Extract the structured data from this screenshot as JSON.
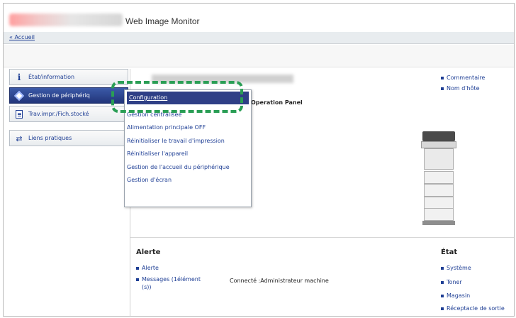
{
  "header": {
    "title": "Web Image Monitor"
  },
  "breadcrumb": {
    "home_link": "« Accueil"
  },
  "sidebar": {
    "items": [
      {
        "label": "État/information",
        "icon": "info-icon"
      },
      {
        "label": "Gestion de périphériq",
        "icon": "device-management-icon"
      },
      {
        "label": "Trav.impr./Fich.stocké",
        "icon": "document-icon"
      },
      {
        "label": "Liens pratiques",
        "icon": "share-link-icon"
      }
    ]
  },
  "main": {
    "operation_panel": "Operation Panel",
    "right_links": [
      "Commentaire",
      "Nom d'hôte"
    ]
  },
  "dropdown": {
    "items": [
      "Configuration",
      "Gestion centralisée",
      "Alimentation principale OFF",
      "Réinitialiser le travail d'impression",
      "Réinitialiser l'appareil",
      "Gestion de l'accueil du périphérique",
      "Gestion d'écran"
    ]
  },
  "alerte": {
    "title": "Alerte",
    "links": [
      "Alerte",
      "Messages (1élément",
      "(s))"
    ],
    "connection_text": "Connecté :Administrateur machine"
  },
  "etat": {
    "title": "État",
    "links": [
      "Système",
      "Toner",
      "Magasin",
      "Réceptacle de sortie"
    ]
  },
  "colors": {
    "accent_blue": "#1f3f95",
    "active_nav": "#2f3f86",
    "highlight_green": "#2a9e55"
  }
}
